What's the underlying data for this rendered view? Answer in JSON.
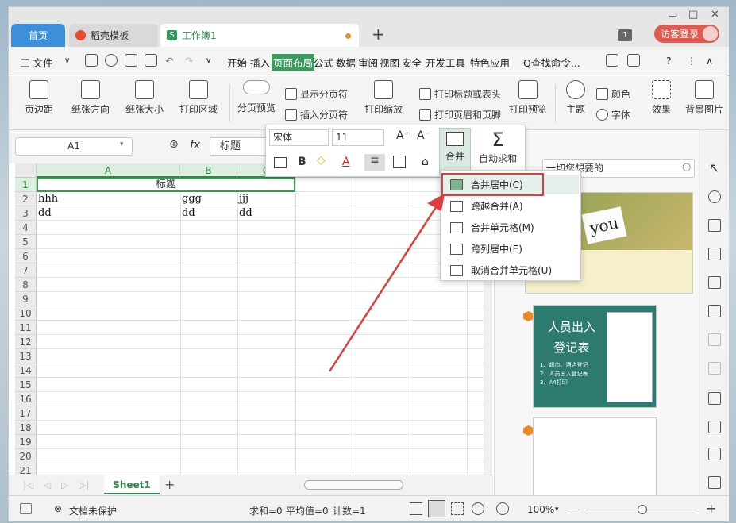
{
  "tabs": {
    "home": "首页",
    "docer": "稻壳模板",
    "workbook": "工作簿1",
    "add": "+",
    "badge": "1",
    "login": "访客登录"
  },
  "menu": {
    "file": "三 文件",
    "items": [
      "开始",
      "插入",
      "页面布局",
      "公式",
      "数据",
      "审阅",
      "视图",
      "安全",
      "开发工具",
      "特色应用"
    ],
    "search_cmd": "Q查找命令...",
    "help": "?"
  },
  "ribbon": {
    "margins": "页边距",
    "orientation": "纸张方向",
    "size": "纸张大小",
    "print_area": "打印区域",
    "page_preview": "分页预览",
    "show_page_break": "显示分页符",
    "insert_page_break": "插入分页符",
    "print_scale": "打印缩放",
    "print_titles": "打印标题或表头",
    "print_header_footer": "打印页眉和页脚",
    "print_preview": "打印预览",
    "theme": "主题",
    "colors": "颜色",
    "fonts": "字体",
    "effects": "效果",
    "background": "背景图片"
  },
  "formula_bar": {
    "name_box": "A1",
    "fx": "fx",
    "value": "标题"
  },
  "float_toolbar": {
    "font_name": "宋体",
    "font_size": "11",
    "merge": "合并",
    "autosum": "自动求和",
    "bold": "B",
    "font_color": "A"
  },
  "merge_menu": {
    "items": [
      "合并居中(C)",
      "跨越合并(A)",
      "合并单元格(M)",
      "跨列居中(E)",
      "取消合并单元格(U)"
    ]
  },
  "sheet": {
    "columns": [
      "A",
      "B",
      "C"
    ],
    "rows": [
      "1",
      "2",
      "3",
      "4",
      "5",
      "6",
      "7",
      "8",
      "9",
      "10",
      "11",
      "12",
      "13",
      "14",
      "15",
      "16",
      "17",
      "18",
      "19",
      "20",
      "21"
    ],
    "merged_title": "标题",
    "cells": {
      "a2": "hhh",
      "b2": "ggg",
      "c2": "jjj",
      "a3": "dd",
      "b3": "dd",
      "c3": "dd"
    },
    "tab": "Sheet1"
  },
  "right_panel": {
    "search_placeholder": "一切您想要的",
    "card1_text": "you",
    "card2_title1": "人员出入",
    "card2_title2": "登记表",
    "card2_lines": [
      "1、超市、酒店登记",
      "2、人员出入登记表",
      "3、A4打印"
    ]
  },
  "status": {
    "protect": "文档未保护",
    "sum": "求和=0",
    "avg": "平均值=0",
    "count": "计数=1",
    "zoom": "100%",
    "zoom_minus": "—",
    "zoom_plus": "+"
  },
  "colors": {
    "accent_green": "#2d8a49",
    "tab_blue": "#3d8fd9",
    "highlight_red": "#e23b3b"
  }
}
